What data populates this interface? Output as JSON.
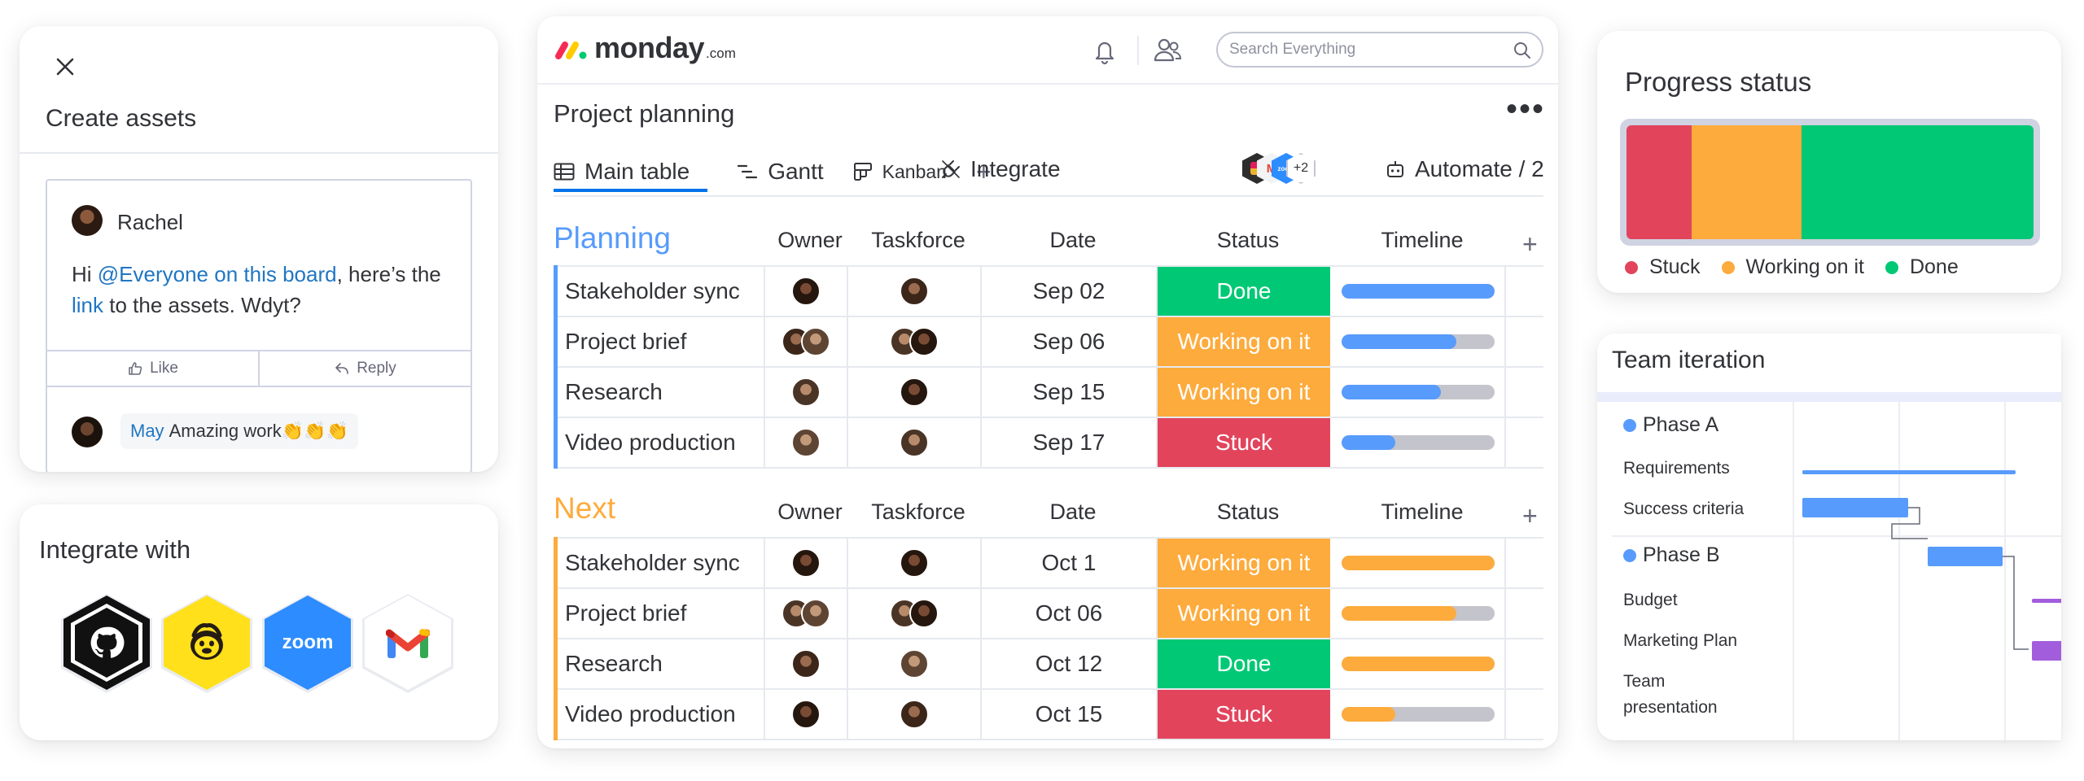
{
  "create_assets": {
    "title": "Create assets",
    "post": {
      "author": "Rachel",
      "text_prefix": "Hi ",
      "mention": "@Everyone on this board",
      "text_mid": ", here’s the ",
      "link_text": "link",
      "text_suffix": " to the assets. Wdyt?",
      "like_label": "Like",
      "reply_label": "Reply"
    },
    "reply": {
      "mention": "May",
      "text": "Amazing work👏👏👏"
    }
  },
  "integrate": {
    "title": "Integrate with",
    "apps": [
      "github-icon",
      "mailchimp-icon",
      "zoom-icon",
      "gmail-icon"
    ],
    "zoom_label": "zoom"
  },
  "board": {
    "logo_text": "monday",
    "logo_suffix": ".com",
    "search_placeholder": "Search Everything",
    "title": "Project planning",
    "more_label": "•••",
    "tabs": {
      "main": "Main table",
      "gantt": "Gantt",
      "kanban": "Kanban",
      "add": "+"
    },
    "integrate_label": "Integrate",
    "apps_more": "+2",
    "automate_label": "Automate / 2",
    "columns": {
      "owner": "Owner",
      "taskforce": "Taskforce",
      "date": "Date",
      "status": "Status",
      "timeline": "Timeline",
      "add": "+"
    },
    "groups": [
      {
        "name": "Planning",
        "color": "#579bfc",
        "rows": [
          {
            "name": "Stakeholder sync",
            "date": "Sep 02",
            "status": "Done",
            "status_color": "#00c875",
            "progress": 1.0
          },
          {
            "name": "Project brief",
            "date": "Sep 06",
            "status": "Working on it",
            "status_color": "#fdab3d",
            "progress": 0.75
          },
          {
            "name": "Research",
            "date": "Sep 15",
            "status": "Working on it",
            "status_color": "#fdab3d",
            "progress": 0.65
          },
          {
            "name": "Video production",
            "date": "Sep 17",
            "status": "Stuck",
            "status_color": "#e2445c",
            "progress": 0.35
          }
        ]
      },
      {
        "name": "Next",
        "color": "#fdab3d",
        "rows": [
          {
            "name": "Stakeholder sync",
            "date": "Oct 1",
            "status": "Working on it",
            "status_color": "#fdab3d",
            "progress": 1.0
          },
          {
            "name": "Project brief",
            "date": "Oct 06",
            "status": "Working on it",
            "status_color": "#fdab3d",
            "progress": 0.75
          },
          {
            "name": "Research",
            "date": "Oct 12",
            "status": "Done",
            "status_color": "#00c875",
            "progress": 1.0
          },
          {
            "name": "Video production",
            "date": "Oct 15",
            "status": "Stuck",
            "status_color": "#e2445c",
            "progress": 0.35
          }
        ]
      }
    ]
  },
  "progress": {
    "title": "Progress status",
    "segments": [
      {
        "label": "Stuck",
        "color": "#e2445c",
        "share": 0.16
      },
      {
        "label": "Working on it",
        "color": "#fdab3d",
        "share": 0.27
      },
      {
        "label": "Done",
        "color": "#00c875",
        "share": 0.57
      }
    ]
  },
  "team": {
    "title": "Team iteration",
    "phase_a": "Phase A",
    "phase_b": "Phase B",
    "tasks": {
      "requirements": "Requirements",
      "success": "Success criteria",
      "budget": "Budget",
      "marketing": "Marketing Plan",
      "team_presentation": "Team presentation"
    }
  }
}
